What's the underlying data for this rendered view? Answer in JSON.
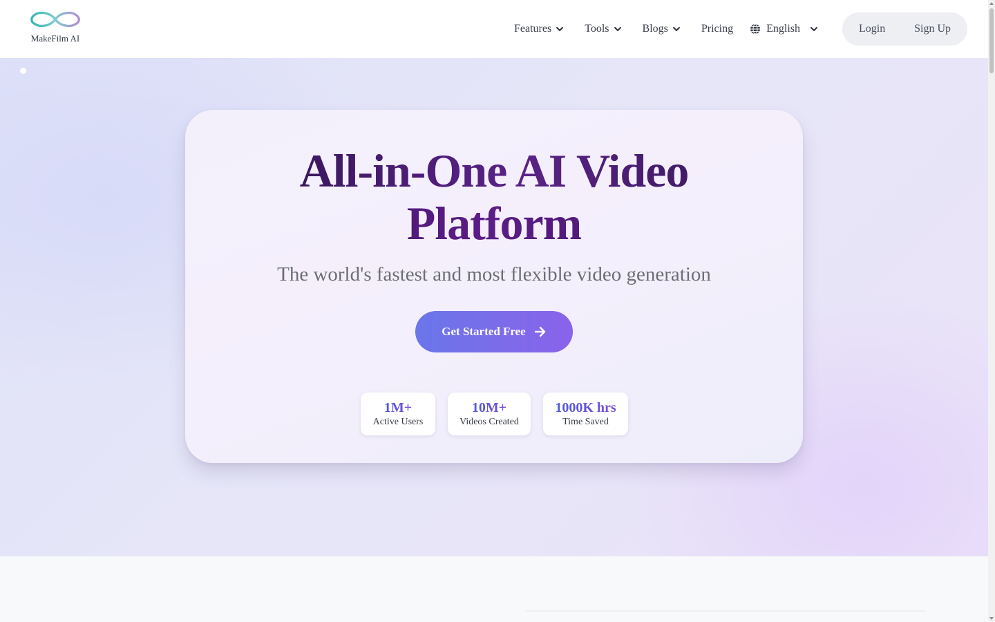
{
  "brand": {
    "name": "MakeFilm AI",
    "logo_icon": "infinity-logo-icon"
  },
  "nav": {
    "features": "Features",
    "tools": "Tools",
    "blogs": "Blogs",
    "pricing": "Pricing",
    "language": "English"
  },
  "auth": {
    "login": "Login",
    "signup": "Sign Up"
  },
  "hero": {
    "title_line1": "All-in-One AI Video",
    "title_line2": "Platform",
    "subtitle": "The world's fastest and most flexible video generation",
    "cta_label": "Get Started Free",
    "stats": [
      {
        "value": "1M+",
        "label": "Active Users"
      },
      {
        "value": "10M+",
        "label": "Videos Created"
      },
      {
        "value": "1000K hrs",
        "label": "Time Saved"
      }
    ]
  },
  "colors": {
    "accent_start": "#6a76ea",
    "accent_end": "#8a63ea",
    "title": "#4e1e7a",
    "logo_teal": "#3bb8b0",
    "logo_purple": "#a98ad0"
  }
}
